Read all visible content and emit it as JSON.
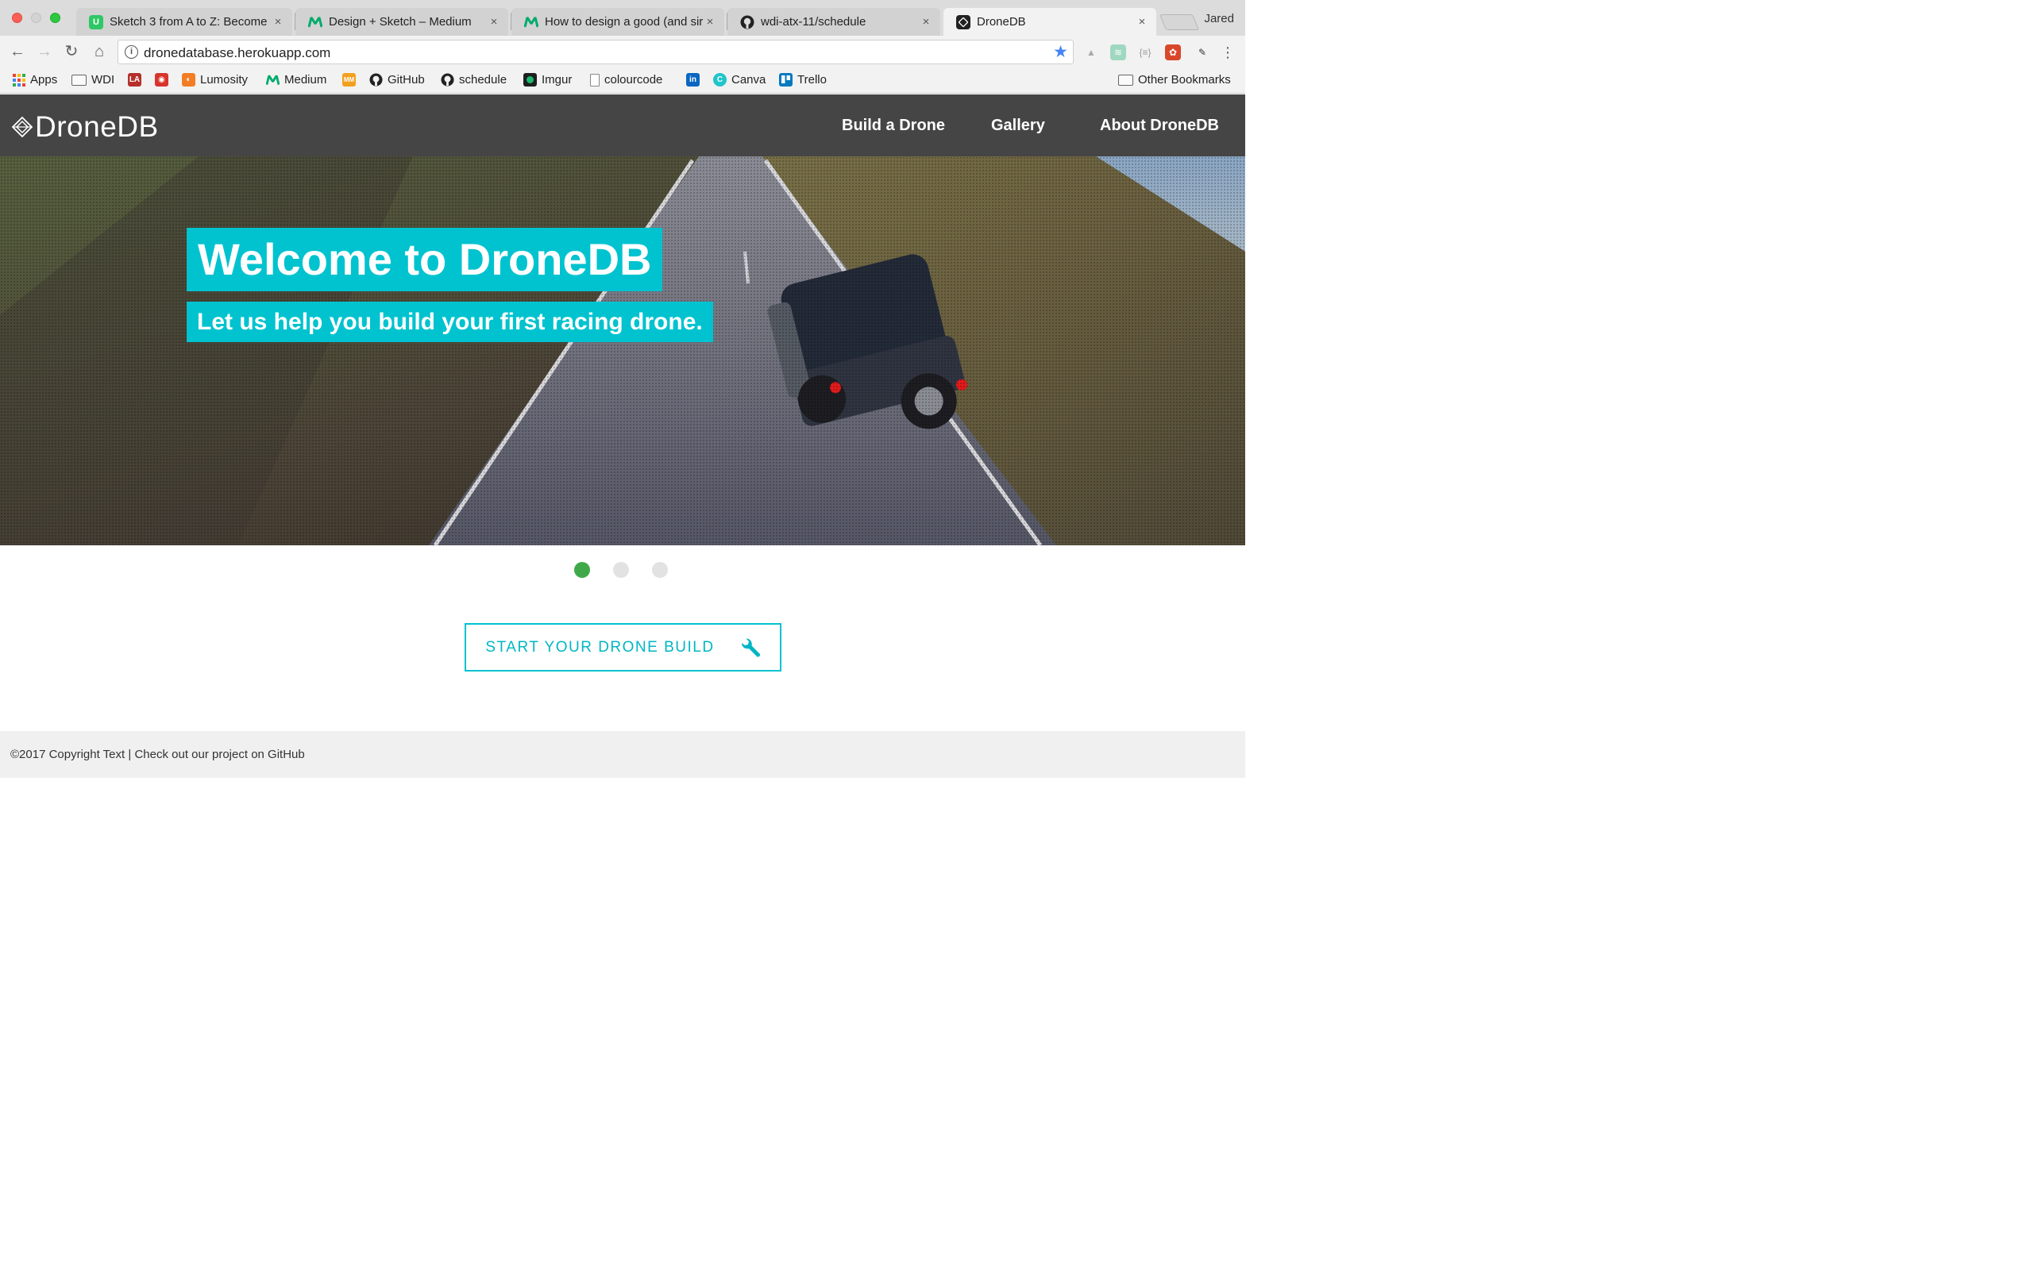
{
  "browser": {
    "tabs": [
      {
        "title": "Sketch 3 from A to Z: Become",
        "favicon": "udemy-icon",
        "favicon_color": "#2ec866",
        "favicon_text": "U"
      },
      {
        "title": "Design + Sketch – Medium",
        "favicon": "medium-icon",
        "favicon_color": "#00ab6c",
        "favicon_text": "M"
      },
      {
        "title": "How to design a good (and sir",
        "favicon": "medium-icon",
        "favicon_color": "#00ab6c",
        "favicon_text": "M"
      },
      {
        "title": "wdi-atx-11/schedule",
        "favicon": "github-icon",
        "favicon_color": "#222222",
        "favicon_text": ""
      },
      {
        "title": "DroneDB",
        "favicon": "dronedb-icon",
        "favicon_color": "#222222",
        "favicon_text": ""
      }
    ],
    "tab_close_glyph": "×",
    "profile_name": "Jared",
    "url": "dronedatabase.herokuapp.com",
    "bookmarks": [
      {
        "label": "Apps",
        "icon": "apps-grid-icon"
      },
      {
        "label": "WDI",
        "icon": "folder-icon"
      },
      {
        "label": "",
        "icon": "lab-icon"
      },
      {
        "label": "",
        "icon": "camera-shutter-icon"
      },
      {
        "label": "Lumosity",
        "icon": "lumosity-icon"
      },
      {
        "label": "Medium",
        "icon": "medium-icon"
      },
      {
        "label": "",
        "icon": "mm-icon"
      },
      {
        "label": "GitHub",
        "icon": "github-icon"
      },
      {
        "label": "schedule",
        "icon": "github-icon"
      },
      {
        "label": "Imgur",
        "icon": "imgur-icon"
      },
      {
        "label": "colourcode",
        "icon": "page-icon"
      },
      {
        "label": "",
        "icon": "linkedin-icon"
      },
      {
        "label": "Canva",
        "icon": "canva-icon"
      },
      {
        "label": "Trello",
        "icon": "trello-icon"
      }
    ],
    "other_bookmarks": "Other Bookmarks"
  },
  "site": {
    "brand": "DroneDB",
    "nav": [
      "Build a Drone",
      "Gallery",
      "About DroneDB"
    ],
    "hero": {
      "title": "Welcome to DroneDB",
      "subtitle": "Let us help you build your first racing drone."
    },
    "carousel": {
      "count": 3,
      "active_index": 0
    },
    "cta": {
      "label": "START YOUR DRONE BUILD",
      "icon": "wrench-icon"
    },
    "footer": {
      "copyright": "©2017 Copyright Text",
      "separator": "|",
      "link": "Check out our project on GitHub"
    },
    "colors": {
      "accent": "#00c3cf",
      "nav_bg": "#454545",
      "active_dot": "#3fa94a",
      "inactive_dot": "#e2e2e2",
      "footer_bg": "#f0f0f0"
    }
  }
}
